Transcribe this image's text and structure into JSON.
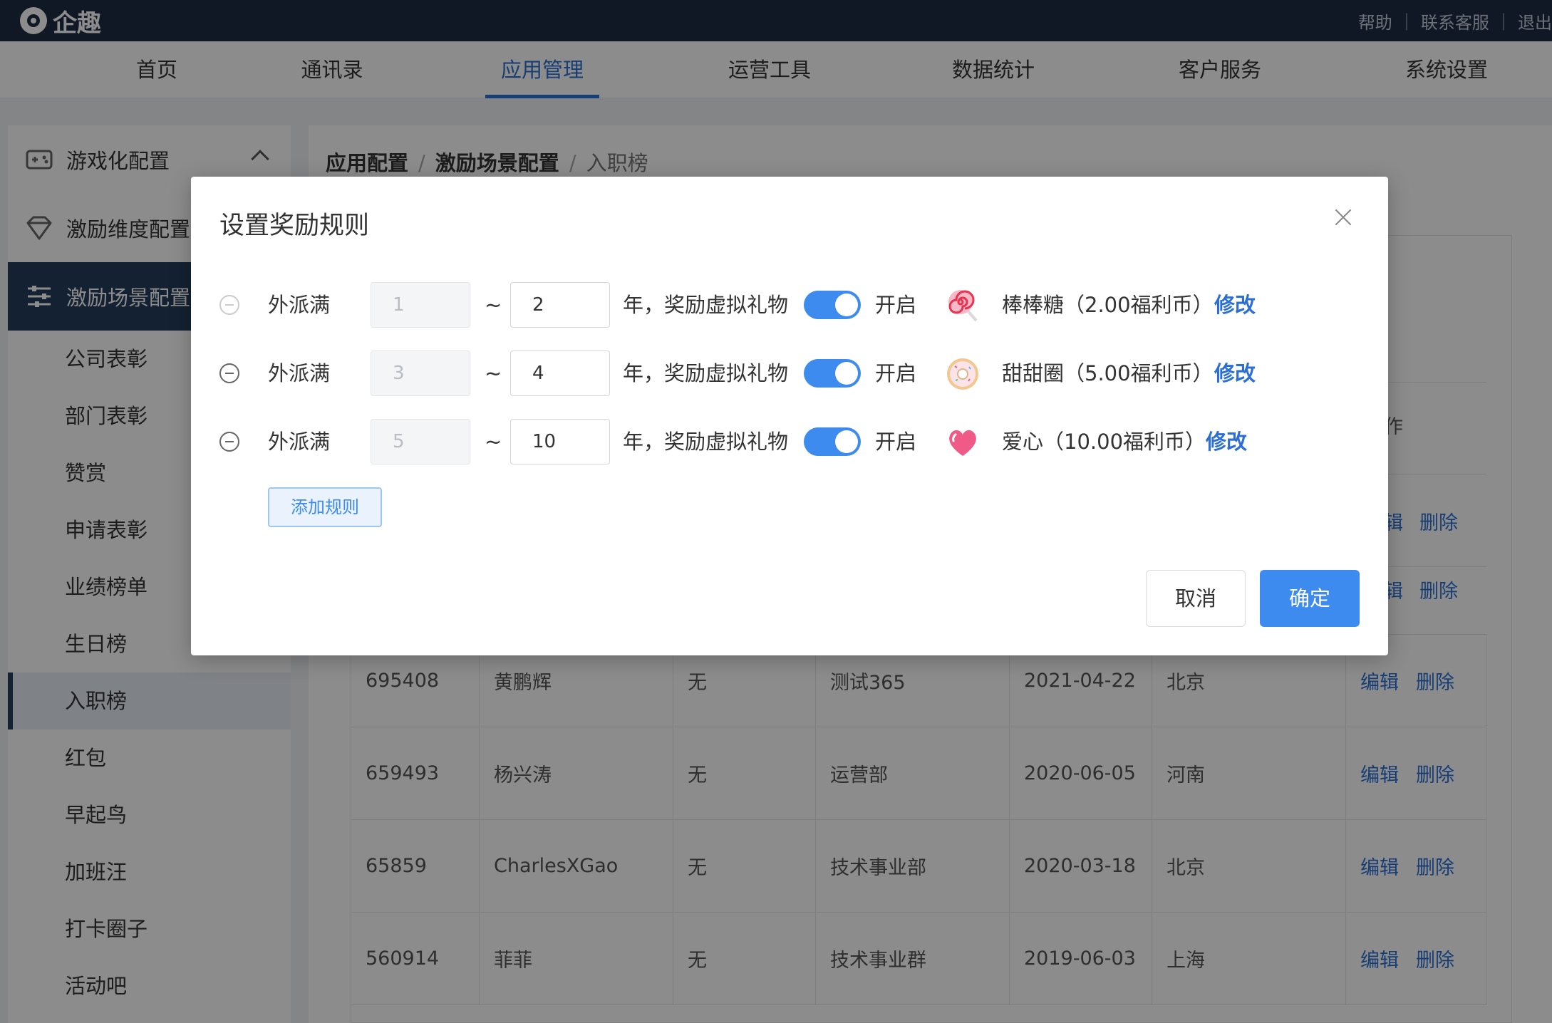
{
  "app": {
    "logo_text": "企趣"
  },
  "toplinks": [
    "帮助",
    "联系客服",
    "退出"
  ],
  "nav": [
    "首页",
    "通讯录",
    "应用管理",
    "运营工具",
    "数据统计",
    "客户服务",
    "系统设置"
  ],
  "nav_active": "应用管理",
  "sidebar": {
    "groups": [
      "游戏化配置",
      "激励维度配置",
      "激励场景配置"
    ],
    "items": [
      "公司表彰",
      "部门表彰",
      "赞赏",
      "申请表彰",
      "业绩榜单",
      "生日榜",
      "入职榜",
      "红包",
      "早起鸟",
      "加班汪",
      "打卡圈子",
      "活动吧"
    ],
    "active_item": "入职榜"
  },
  "breadcrumb": [
    "应用配置",
    "激励场景配置",
    "入职榜"
  ],
  "table": {
    "header_fragment": "作",
    "partial_actions": [
      "辑",
      "删除"
    ],
    "rows": [
      {
        "id": "695408",
        "name": "黄鹏辉",
        "col3": "无",
        "dept": "测试365",
        "date": "2021-04-22",
        "city": "北京"
      },
      {
        "id": "659493",
        "name": "杨兴涛",
        "col3": "无",
        "dept": "运营部",
        "date": "2020-06-05",
        "city": "河南"
      },
      {
        "id": "65859",
        "name": "CharlesXGao",
        "col3": "无",
        "dept": "技术事业部",
        "date": "2020-03-18",
        "city": "北京"
      },
      {
        "id": "560914",
        "name": "菲菲",
        "col3": "无",
        "dept": "技术事业群",
        "date": "2019-06-03",
        "city": "上海"
      }
    ],
    "edit_label": "编辑",
    "delete_label": "删除"
  },
  "modal": {
    "title": "设置奖励规则",
    "label_prefix": "外派满",
    "tilde": "~",
    "label_mid": "年，奖励虚拟礼物",
    "switch_label": "开启",
    "modify_label": "修改",
    "rules": [
      {
        "from": "1",
        "to": "2",
        "gift": "棒棒糖（2.00福利币）",
        "gift_icon": "lollipop-icon",
        "on": true
      },
      {
        "from": "3",
        "to": "4",
        "gift": "甜甜圈（5.00福利币）",
        "gift_icon": "donut-icon",
        "on": true
      },
      {
        "from": "5",
        "to": "10",
        "gift": "爱心（10.00福利币）",
        "gift_icon": "heart-icon",
        "on": true
      }
    ],
    "add_rule": "添加规则",
    "cancel": "取消",
    "ok": "确定"
  },
  "colors": {
    "topbar": "#1f2d44",
    "accent": "#3d8bef",
    "link": "#2b6fd6",
    "sidebar_active": "#233c5c"
  }
}
